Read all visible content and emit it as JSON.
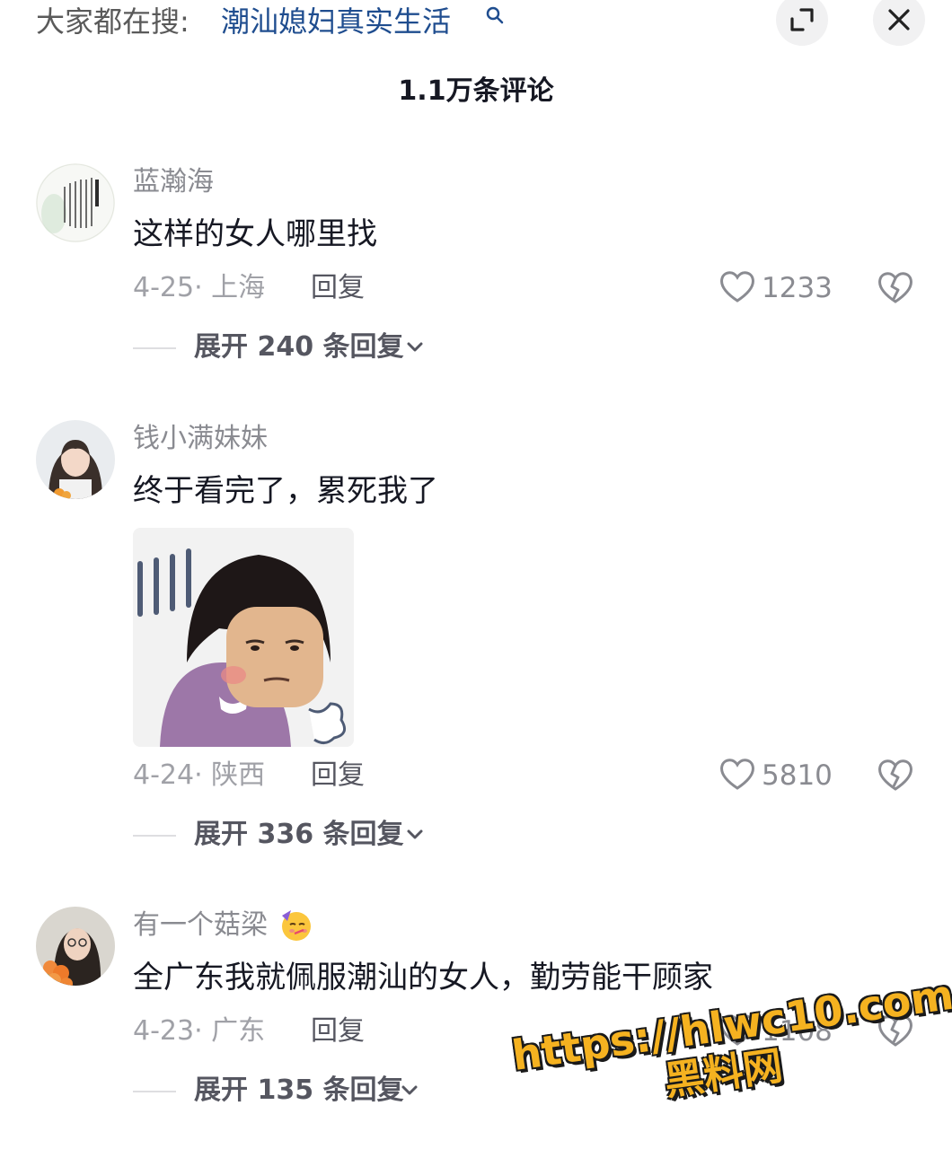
{
  "search": {
    "prefix": "大家都在搜:",
    "query": "潮汕媳妇真实生活"
  },
  "header": {
    "comment_count": "1.1万条评论"
  },
  "comments": [
    {
      "username": "蓝瀚海",
      "text": "这样的女人哪里找",
      "meta": "4-25· 上海",
      "reply": "回复",
      "likes": "1233",
      "expand": "展开 240 条回复"
    },
    {
      "username": "钱小满妹妹",
      "text": "终于看完了，累死我了",
      "meta": "4-24· 陕西",
      "reply": "回复",
      "likes": "5810",
      "expand": "展开 336 条回复"
    },
    {
      "username": "有一个菇梁",
      "text": "全广东我就佩服潮汕的女人，勤劳能干顾家",
      "meta": "4-23· 广东",
      "reply": "回复",
      "likes": "1108",
      "expand": "展开 135 条回复"
    }
  ],
  "watermark": {
    "line1": "https://hlwc10.com",
    "line2": "黑料网"
  },
  "colors": {
    "link": "#1f4d8f",
    "watermark": "#f5b220",
    "muted": "#8a8b91"
  },
  "icons": [
    "search-icon",
    "expand-icon",
    "close-icon",
    "heart-icon",
    "dislike-heart-icon",
    "chevron-down-icon"
  ]
}
